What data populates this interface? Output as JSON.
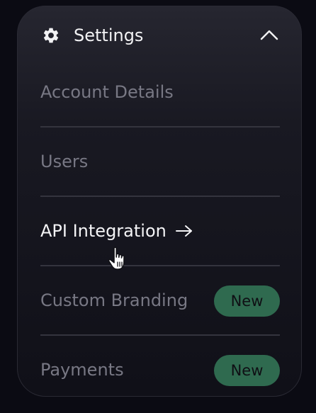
{
  "settings": {
    "title": "Settings",
    "items": [
      {
        "label": "Account Details",
        "badge": ""
      },
      {
        "label": "Users",
        "badge": ""
      },
      {
        "label": "API Integration",
        "badge": ""
      },
      {
        "label": "Custom Branding",
        "badge": "New"
      },
      {
        "label": "Payments",
        "badge": "New"
      }
    ]
  },
  "icons": {
    "header": "gear-icon",
    "toggle": "chevron-up-icon",
    "active_item": "arrow-right-icon",
    "pointer": "hand-cursor-icon"
  },
  "colors": {
    "background": "#0b0b13",
    "panel": "#191922",
    "text_active": "#f4f4f6",
    "text_muted": "#787884",
    "badge_bg": "#2f6a4f",
    "divider": "#34343e"
  }
}
